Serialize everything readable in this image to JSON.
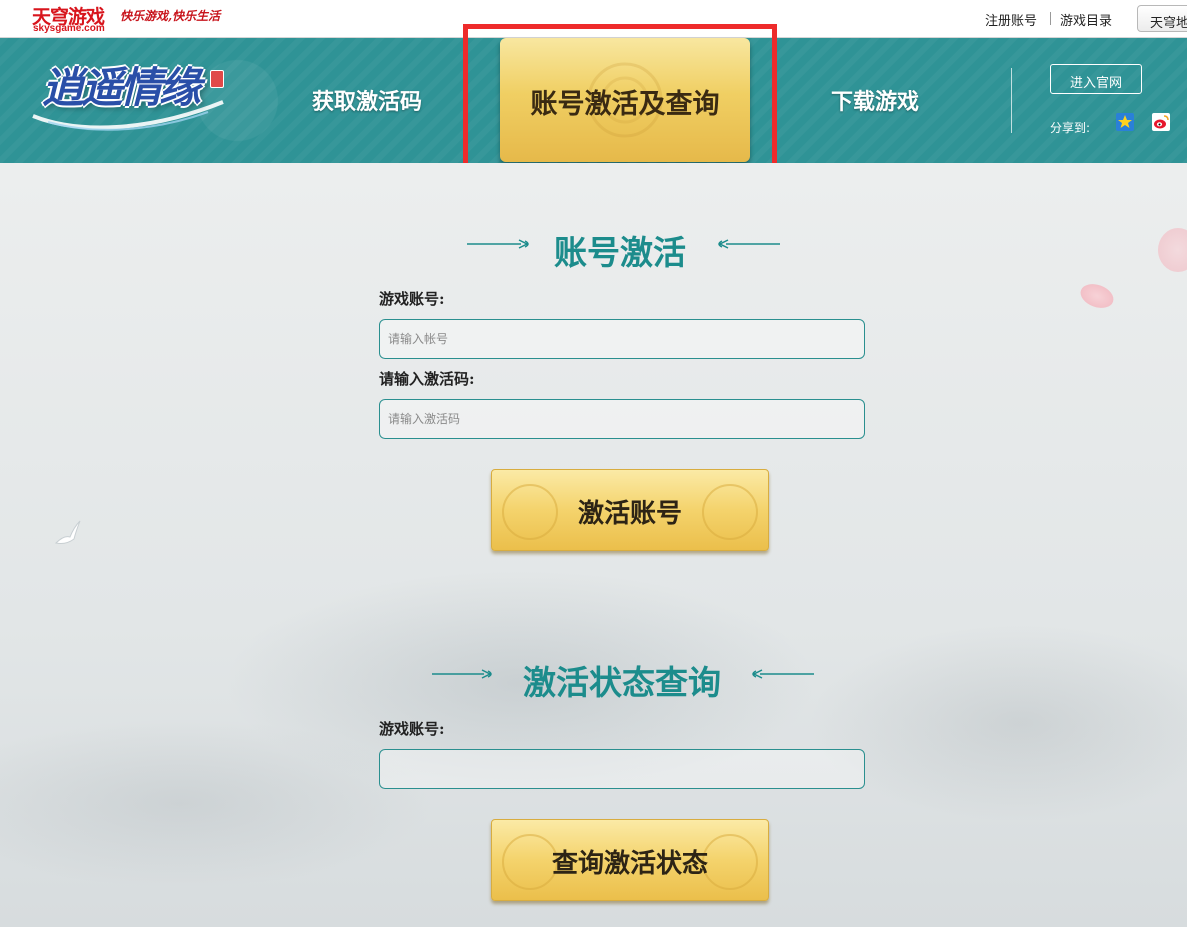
{
  "topbar": {
    "brand_cn": "天穹游戏",
    "brand_en": "skysgame.com",
    "slogan": "快乐游戏,快乐生活",
    "register_link": "注册账号",
    "games_link": "游戏目录",
    "dropdown_label": "天穹地"
  },
  "nav": {
    "logo_text": "逍遥情缘",
    "items": [
      "获取激活码",
      "账号激活及查询",
      "下载游戏"
    ],
    "active_index": 1,
    "official_button": "进入官网",
    "share_label": "分享到:"
  },
  "activation": {
    "title": "账号激活",
    "account_label": "游戏账号:",
    "account_placeholder": "请输入帐号",
    "code_label": "请输入激活码:",
    "code_placeholder": "请输入激活码",
    "submit_label": "激活账号"
  },
  "query": {
    "title": "激活状态查询",
    "account_label": "游戏账号:",
    "account_placeholder": "",
    "submit_label": "查询激活状态"
  },
  "colors": {
    "teal": "#2f9396",
    "title_teal": "#1c8c8c",
    "gold": "#f0cf63",
    "highlight_red": "#ee2b2b",
    "brand_red": "#d8151d"
  },
  "icons": {
    "share_qzone": "qzone-icon",
    "share_weibo": "weibo-icon"
  }
}
